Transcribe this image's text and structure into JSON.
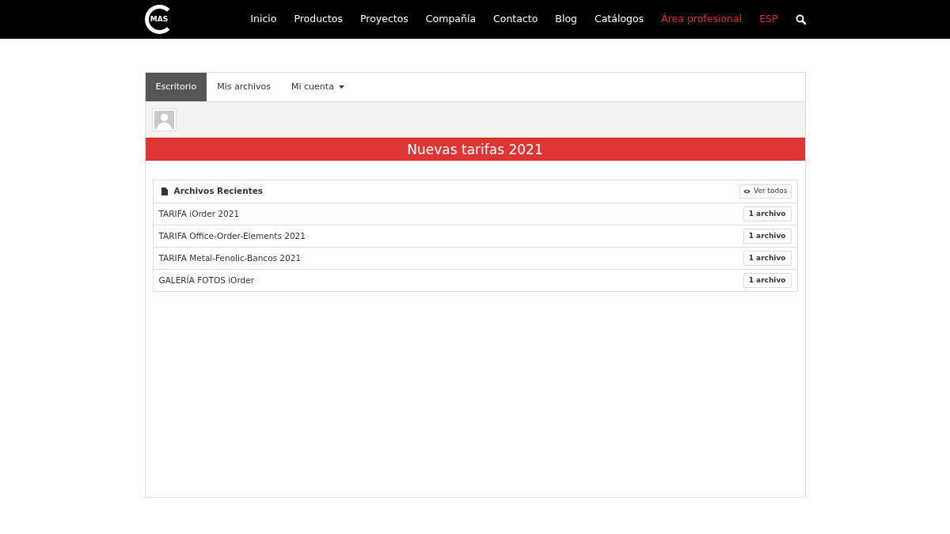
{
  "header": {
    "logo_text": "MAS",
    "nav": [
      {
        "label": "Inicio",
        "accent": false
      },
      {
        "label": "Productos",
        "accent": false
      },
      {
        "label": "Proyectos",
        "accent": false
      },
      {
        "label": "Compañía",
        "accent": false
      },
      {
        "label": "Contacto",
        "accent": false
      },
      {
        "label": "Blog",
        "accent": false
      },
      {
        "label": "Catálogos",
        "accent": false
      },
      {
        "label": "Área profesional",
        "accent": true
      },
      {
        "label": "ESP",
        "accent": true
      }
    ]
  },
  "tabs": [
    {
      "label": "Escritorio",
      "selected": true,
      "dropdown": false
    },
    {
      "label": "Mis archivos",
      "selected": false,
      "dropdown": false
    },
    {
      "label": "Mi cuenta",
      "selected": false,
      "dropdown": true
    }
  ],
  "banner": "Nuevas tarifas 2021",
  "recent": {
    "title": "Archivos Recientes",
    "view_all": "Ver todos",
    "items": [
      {
        "name": "TARIFA iOrder 2021",
        "count": "1 archivo"
      },
      {
        "name": "TARIFA Office-Order-Elements 2021",
        "count": "1 archivo"
      },
      {
        "name": "TARIFA Metal-Fenolic-Bancos 2021",
        "count": "1 archivo"
      },
      {
        "name": "GALERÍA FOTOS iOrder",
        "count": "1 archivo"
      }
    ]
  }
}
